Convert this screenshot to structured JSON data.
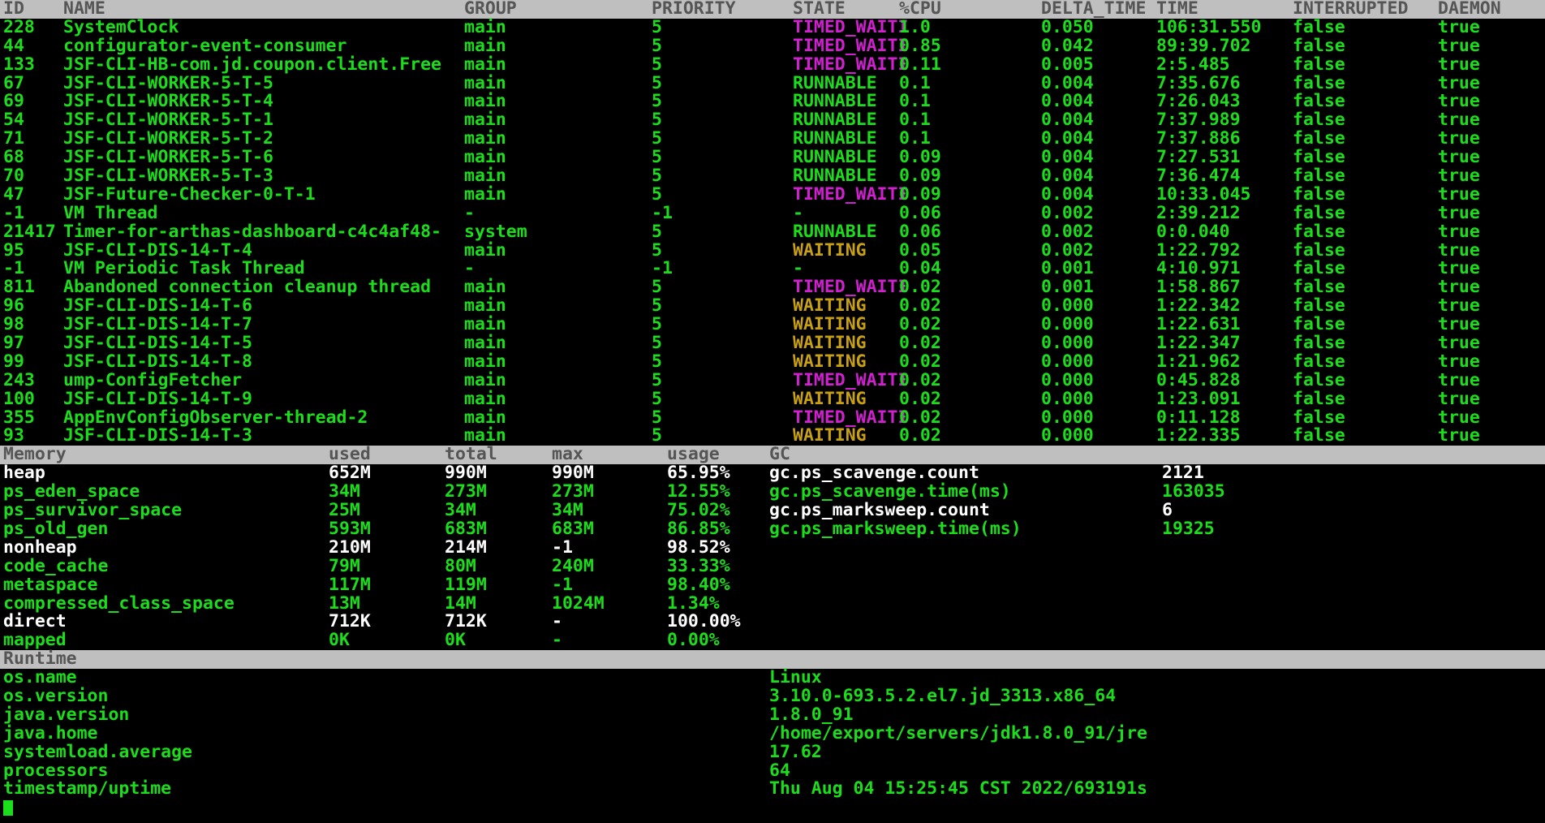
{
  "terminal": {
    "title": "arthas-dashboard",
    "cursor_visible": true,
    "colors": {
      "background": "#000000",
      "green": "#1cdd1c",
      "white": "#ffffff",
      "magenta": "#d020d0",
      "yellow": "#c8a013",
      "header_bg": "#bfbfbf",
      "header_fg": "#4d4d4d"
    }
  },
  "threads": {
    "section_label": "",
    "columns": [
      "ID",
      "NAME",
      "GROUP",
      "PRIORITY",
      "STATE",
      "%CPU",
      "DELTA_TIME",
      "TIME",
      "INTERRUPTED",
      "DAEMON"
    ],
    "rows": [
      {
        "id": "228",
        "name": "SystemClock",
        "group": "main",
        "priority": "5",
        "state": "TIMED_WAITI",
        "state_color": "magenta",
        "cpu": "1.0",
        "delta_time": "0.050",
        "time": "106:31.550",
        "interrupted": "false",
        "daemon": "true"
      },
      {
        "id": "44",
        "name": "configurator-event-consumer",
        "group": "main",
        "priority": "5",
        "state": "TIMED_WAITI",
        "state_color": "magenta",
        "cpu": "0.85",
        "delta_time": "0.042",
        "time": "89:39.702",
        "interrupted": "false",
        "daemon": "true"
      },
      {
        "id": "133",
        "name": "JSF-CLI-HB-com.jd.coupon.client.Free",
        "group": "main",
        "priority": "5",
        "state": "TIMED_WAITI",
        "state_color": "magenta",
        "cpu": "0.11",
        "delta_time": "0.005",
        "time": "2:5.485",
        "interrupted": "false",
        "daemon": "true"
      },
      {
        "id": "67",
        "name": "JSF-CLI-WORKER-5-T-5",
        "group": "main",
        "priority": "5",
        "state": "RUNNABLE",
        "state_color": "green",
        "cpu": "0.1",
        "delta_time": "0.004",
        "time": "7:35.676",
        "interrupted": "false",
        "daemon": "true"
      },
      {
        "id": "69",
        "name": "JSF-CLI-WORKER-5-T-4",
        "group": "main",
        "priority": "5",
        "state": "RUNNABLE",
        "state_color": "green",
        "cpu": "0.1",
        "delta_time": "0.004",
        "time": "7:26.043",
        "interrupted": "false",
        "daemon": "true"
      },
      {
        "id": "54",
        "name": "JSF-CLI-WORKER-5-T-1",
        "group": "main",
        "priority": "5",
        "state": "RUNNABLE",
        "state_color": "green",
        "cpu": "0.1",
        "delta_time": "0.004",
        "time": "7:37.989",
        "interrupted": "false",
        "daemon": "true"
      },
      {
        "id": "71",
        "name": "JSF-CLI-WORKER-5-T-2",
        "group": "main",
        "priority": "5",
        "state": "RUNNABLE",
        "state_color": "green",
        "cpu": "0.1",
        "delta_time": "0.004",
        "time": "7:37.886",
        "interrupted": "false",
        "daemon": "true"
      },
      {
        "id": "68",
        "name": "JSF-CLI-WORKER-5-T-6",
        "group": "main",
        "priority": "5",
        "state": "RUNNABLE",
        "state_color": "green",
        "cpu": "0.09",
        "delta_time": "0.004",
        "time": "7:27.531",
        "interrupted": "false",
        "daemon": "true"
      },
      {
        "id": "70",
        "name": "JSF-CLI-WORKER-5-T-3",
        "group": "main",
        "priority": "5",
        "state": "RUNNABLE",
        "state_color": "green",
        "cpu": "0.09",
        "delta_time": "0.004",
        "time": "7:36.474",
        "interrupted": "false",
        "daemon": "true"
      },
      {
        "id": "47",
        "name": "JSF-Future-Checker-0-T-1",
        "group": "main",
        "priority": "5",
        "state": "TIMED_WAITI",
        "state_color": "magenta",
        "cpu": "0.09",
        "delta_time": "0.004",
        "time": "10:33.045",
        "interrupted": "false",
        "daemon": "true"
      },
      {
        "id": "-1",
        "name": "VM Thread",
        "group": "-",
        "priority": "-1",
        "state": "-",
        "state_color": "green",
        "cpu": "0.06",
        "delta_time": "0.002",
        "time": "2:39.212",
        "interrupted": "false",
        "daemon": "true"
      },
      {
        "id": "21417",
        "name": "Timer-for-arthas-dashboard-c4c4af48-",
        "group": "system",
        "priority": "5",
        "state": "RUNNABLE",
        "state_color": "green",
        "cpu": "0.06",
        "delta_time": "0.002",
        "time": "0:0.040",
        "interrupted": "false",
        "daemon": "true"
      },
      {
        "id": "95",
        "name": "JSF-CLI-DIS-14-T-4",
        "group": "main",
        "priority": "5",
        "state": "WAITING",
        "state_color": "yellow",
        "cpu": "0.05",
        "delta_time": "0.002",
        "time": "1:22.792",
        "interrupted": "false",
        "daemon": "true"
      },
      {
        "id": "-1",
        "name": "VM Periodic Task Thread",
        "group": "-",
        "priority": "-1",
        "state": "-",
        "state_color": "green",
        "cpu": "0.04",
        "delta_time": "0.001",
        "time": "4:10.971",
        "interrupted": "false",
        "daemon": "true"
      },
      {
        "id": "811",
        "name": "Abandoned connection cleanup thread",
        "group": "main",
        "priority": "5",
        "state": "TIMED_WAITI",
        "state_color": "magenta",
        "cpu": "0.02",
        "delta_time": "0.001",
        "time": "1:58.867",
        "interrupted": "false",
        "daemon": "true"
      },
      {
        "id": "96",
        "name": "JSF-CLI-DIS-14-T-6",
        "group": "main",
        "priority": "5",
        "state": "WAITING",
        "state_color": "yellow",
        "cpu": "0.02",
        "delta_time": "0.000",
        "time": "1:22.342",
        "interrupted": "false",
        "daemon": "true"
      },
      {
        "id": "98",
        "name": "JSF-CLI-DIS-14-T-7",
        "group": "main",
        "priority": "5",
        "state": "WAITING",
        "state_color": "yellow",
        "cpu": "0.02",
        "delta_time": "0.000",
        "time": "1:22.631",
        "interrupted": "false",
        "daemon": "true"
      },
      {
        "id": "97",
        "name": "JSF-CLI-DIS-14-T-5",
        "group": "main",
        "priority": "5",
        "state": "WAITING",
        "state_color": "yellow",
        "cpu": "0.02",
        "delta_time": "0.000",
        "time": "1:22.347",
        "interrupted": "false",
        "daemon": "true"
      },
      {
        "id": "99",
        "name": "JSF-CLI-DIS-14-T-8",
        "group": "main",
        "priority": "5",
        "state": "WAITING",
        "state_color": "yellow",
        "cpu": "0.02",
        "delta_time": "0.000",
        "time": "1:21.962",
        "interrupted": "false",
        "daemon": "true"
      },
      {
        "id": "243",
        "name": "ump-ConfigFetcher",
        "group": "main",
        "priority": "5",
        "state": "TIMED_WAITI",
        "state_color": "magenta",
        "cpu": "0.02",
        "delta_time": "0.000",
        "time": "0:45.828",
        "interrupted": "false",
        "daemon": "true"
      },
      {
        "id": "100",
        "name": "JSF-CLI-DIS-14-T-9",
        "group": "main",
        "priority": "5",
        "state": "WAITING",
        "state_color": "yellow",
        "cpu": "0.02",
        "delta_time": "0.000",
        "time": "1:23.091",
        "interrupted": "false",
        "daemon": "true"
      },
      {
        "id": "355",
        "name": "AppEnvConfigObserver-thread-2",
        "group": "main",
        "priority": "5",
        "state": "TIMED_WAITI",
        "state_color": "magenta",
        "cpu": "0.02",
        "delta_time": "0.000",
        "time": "0:11.128",
        "interrupted": "false",
        "daemon": "true"
      },
      {
        "id": "93",
        "name": "JSF-CLI-DIS-14-T-3",
        "group": "main",
        "priority": "5",
        "state": "WAITING",
        "state_color": "yellow",
        "cpu": "0.02",
        "delta_time": "0.000",
        "time": "1:22.335",
        "interrupted": "false",
        "daemon": "true"
      }
    ]
  },
  "memory": {
    "columns": [
      "Memory",
      "used",
      "total",
      "max",
      "usage",
      "GC"
    ],
    "rows": [
      {
        "name": "heap",
        "used": "652M",
        "total": "990M",
        "max": "990M",
        "usage": "65.95%",
        "color": "white"
      },
      {
        "name": "ps_eden_space",
        "used": "34M",
        "total": "273M",
        "max": "273M",
        "usage": "12.55%",
        "color": "green"
      },
      {
        "name": "ps_survivor_space",
        "used": "25M",
        "total": "34M",
        "max": "34M",
        "usage": "75.02%",
        "color": "green"
      },
      {
        "name": "ps_old_gen",
        "used": "593M",
        "total": "683M",
        "max": "683M",
        "usage": "86.85%",
        "color": "green"
      },
      {
        "name": "nonheap",
        "used": "210M",
        "total": "214M",
        "max": "-1",
        "usage": "98.52%",
        "color": "white"
      },
      {
        "name": "code_cache",
        "used": "79M",
        "total": "80M",
        "max": "240M",
        "usage": "33.33%",
        "color": "green"
      },
      {
        "name": "metaspace",
        "used": "117M",
        "total": "119M",
        "max": "-1",
        "usage": "98.40%",
        "color": "green"
      },
      {
        "name": "compressed_class_space",
        "used": "13M",
        "total": "14M",
        "max": "1024M",
        "usage": "1.34%",
        "color": "green"
      },
      {
        "name": "direct",
        "used": "712K",
        "total": "712K",
        "max": "-",
        "usage": "100.00%",
        "color": "white"
      },
      {
        "name": "mapped",
        "used": "0K",
        "total": "0K",
        "max": "-",
        "usage": "0.00%",
        "color": "green"
      }
    ],
    "gc": [
      {
        "name": "gc.ps_scavenge.count",
        "value": "2121",
        "color": "white"
      },
      {
        "name": "gc.ps_scavenge.time(ms)",
        "value": "163035",
        "color": "green"
      },
      {
        "name": "gc.ps_marksweep.count",
        "value": "6",
        "color": "white"
      },
      {
        "name": "gc.ps_marksweep.time(ms)",
        "value": "19325",
        "color": "green"
      }
    ]
  },
  "runtime": {
    "section_label": "Runtime",
    "rows": [
      {
        "key": "os.name",
        "value": "Linux"
      },
      {
        "key": "os.version",
        "value": "3.10.0-693.5.2.el7.jd_3313.x86_64"
      },
      {
        "key": "java.version",
        "value": "1.8.0_91"
      },
      {
        "key": "java.home",
        "value": "/home/export/servers/jdk1.8.0_91/jre"
      },
      {
        "key": "systemload.average",
        "value": "17.62"
      },
      {
        "key": "processors",
        "value": "64"
      },
      {
        "key": "timestamp/uptime",
        "value": "Thu Aug 04 15:25:45 CST 2022/693191s"
      }
    ]
  }
}
